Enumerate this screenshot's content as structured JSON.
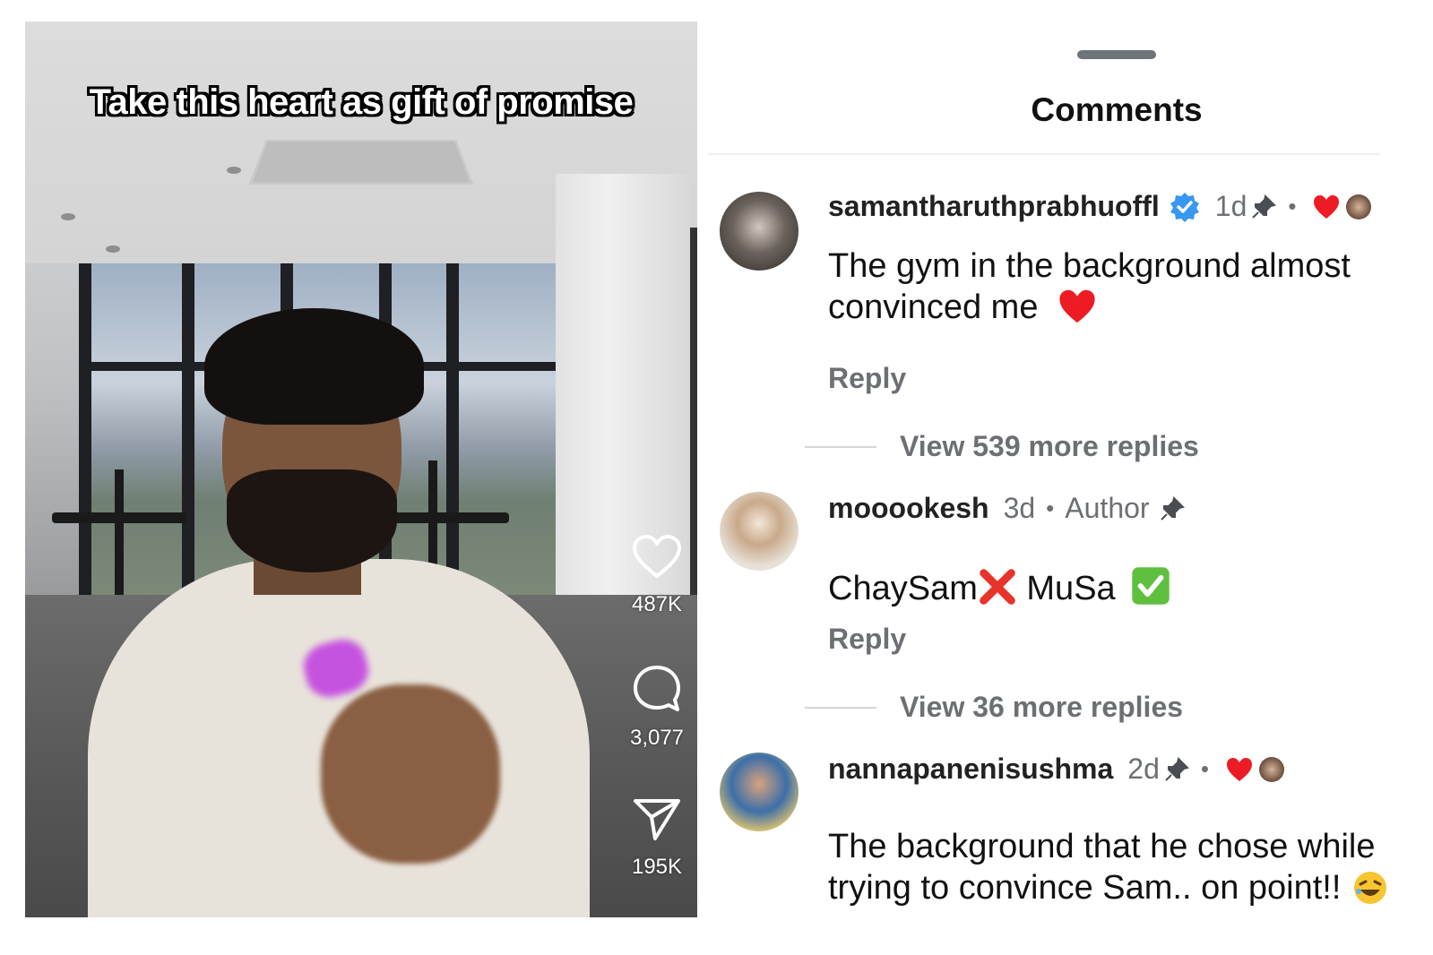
{
  "video": {
    "caption": "Take this heart as gift of promise",
    "likes": "487K",
    "comments": "3,077",
    "shares": "195K"
  },
  "sheet": {
    "title": "Comments",
    "reply_label": "Reply",
    "comments": [
      {
        "username": "samantharuthprabhuoffl",
        "verified": true,
        "time": "1d",
        "pinned": true,
        "liked_by_author": true,
        "text_line1": "The gym in the background almost",
        "text_line2": "convinced me",
        "emoji": "❤️",
        "view_more": "View 539 more replies"
      },
      {
        "username": "mooookesh",
        "time": "3d",
        "author_label": "Author",
        "pinned": true,
        "text_a": "ChaySam",
        "emoji_a": "❌",
        "text_b": " MuSa ",
        "emoji_b": "✅",
        "view_more": "View 36 more replies"
      },
      {
        "username": "nannapanenisushma",
        "time": "2d",
        "pinned": true,
        "liked_by_author": true,
        "text_line1": "The background that he chose while",
        "text_line2": "trying to convince Sam.. on point!!",
        "emoji": "😂"
      }
    ]
  },
  "colors": {
    "verified": "#3897f0",
    "like_red": "#ed1c24",
    "meta_gray": "#6c6f73",
    "grabber": "#6f747b"
  }
}
